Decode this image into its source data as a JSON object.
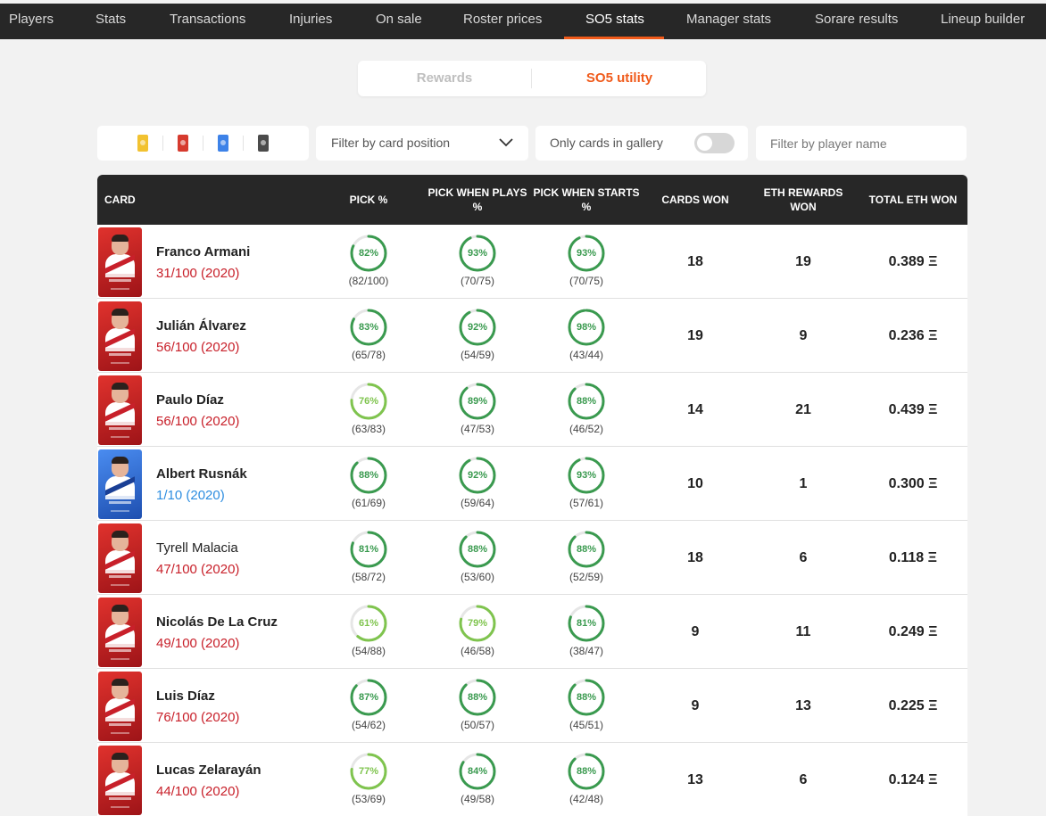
{
  "nav": {
    "tabs": [
      {
        "label": "Players"
      },
      {
        "label": "Stats"
      },
      {
        "label": "Transactions"
      },
      {
        "label": "Injuries"
      },
      {
        "label": "On sale"
      },
      {
        "label": "Roster prices"
      },
      {
        "label": "SO5 stats"
      },
      {
        "label": "Manager stats"
      },
      {
        "label": "Sorare results"
      },
      {
        "label": "Lineup builder"
      }
    ],
    "active": "SO5 stats"
  },
  "switcher": {
    "rewards": "Rewards",
    "utility": "SO5 utility",
    "active": "SO5 utility"
  },
  "filters": {
    "rarities": [
      "limited",
      "rare",
      "super-rare",
      "unique"
    ],
    "position_placeholder": "Filter by card position",
    "gallery_label": "Only cards in gallery",
    "gallery_on": false,
    "name_placeholder": "Filter by player name"
  },
  "table": {
    "headers": {
      "card": "CARD",
      "pick": "PICK %",
      "pick_plays": "PICK WHEN PLAYS %",
      "pick_starts": "PICK WHEN STARTS %",
      "cards_won": "CARDS WON",
      "eth_rewards": "ETH REWARDS WON",
      "total_eth": "TOTAL ETH WON"
    },
    "rows": [
      {
        "name": "Franco Armani",
        "serial": "31/100 (2020)",
        "rarity": "rare",
        "pick": {
          "pct": "82%",
          "frac": "(82/100)",
          "value": 82
        },
        "plays": {
          "pct": "93%",
          "frac": "(70/75)",
          "value": 93
        },
        "starts": {
          "pct": "93%",
          "frac": "(70/75)",
          "value": 93
        },
        "cards_won": "18",
        "eth_rewards": "19",
        "total_eth": "0.389 Ξ"
      },
      {
        "name": "Julián Álvarez",
        "serial": "56/100 (2020)",
        "rarity": "rare",
        "pick": {
          "pct": "83%",
          "frac": "(65/78)",
          "value": 83
        },
        "plays": {
          "pct": "92%",
          "frac": "(54/59)",
          "value": 92
        },
        "starts": {
          "pct": "98%",
          "frac": "(43/44)",
          "value": 98
        },
        "cards_won": "19",
        "eth_rewards": "9",
        "total_eth": "0.236 Ξ"
      },
      {
        "name": "Paulo Díaz",
        "serial": "56/100 (2020)",
        "rarity": "rare",
        "pick": {
          "pct": "76%",
          "frac": "(63/83)",
          "value": 76
        },
        "plays": {
          "pct": "89%",
          "frac": "(47/53)",
          "value": 89
        },
        "starts": {
          "pct": "88%",
          "frac": "(46/52)",
          "value": 88
        },
        "cards_won": "14",
        "eth_rewards": "21",
        "total_eth": "0.439 Ξ"
      },
      {
        "name": "Albert Rusnák",
        "serial": "1/10 (2020)",
        "rarity": "super-rare",
        "pick": {
          "pct": "88%",
          "frac": "(61/69)",
          "value": 88
        },
        "plays": {
          "pct": "92%",
          "frac": "(59/64)",
          "value": 92
        },
        "starts": {
          "pct": "93%",
          "frac": "(57/61)",
          "value": 93
        },
        "cards_won": "10",
        "eth_rewards": "1",
        "total_eth": "0.300 Ξ"
      },
      {
        "name": "Tyrell Malacia",
        "serial": "47/100 (2020)",
        "rarity": "rare",
        "pick": {
          "pct": "81%",
          "frac": "(58/72)",
          "value": 81
        },
        "plays": {
          "pct": "88%",
          "frac": "(53/60)",
          "value": 88
        },
        "starts": {
          "pct": "88%",
          "frac": "(52/59)",
          "value": 88
        },
        "cards_won": "18",
        "eth_rewards": "6",
        "total_eth": "0.118 Ξ"
      },
      {
        "name": "Nicolás De La Cruz",
        "serial": "49/100 (2020)",
        "rarity": "rare",
        "pick": {
          "pct": "61%",
          "frac": "(54/88)",
          "value": 61
        },
        "plays": {
          "pct": "79%",
          "frac": "(46/58)",
          "value": 79
        },
        "starts": {
          "pct": "81%",
          "frac": "(38/47)",
          "value": 81
        },
        "cards_won": "9",
        "eth_rewards": "11",
        "total_eth": "0.249 Ξ"
      },
      {
        "name": "Luis Díaz",
        "serial": "76/100 (2020)",
        "rarity": "rare",
        "pick": {
          "pct": "87%",
          "frac": "(54/62)",
          "value": 87
        },
        "plays": {
          "pct": "88%",
          "frac": "(50/57)",
          "value": 88
        },
        "starts": {
          "pct": "88%",
          "frac": "(45/51)",
          "value": 88
        },
        "cards_won": "9",
        "eth_rewards": "13",
        "total_eth": "0.225 Ξ"
      },
      {
        "name": "Lucas Zelarayán",
        "serial": "44/100 (2020)",
        "rarity": "rare",
        "pick": {
          "pct": "77%",
          "frac": "(53/69)",
          "value": 77
        },
        "plays": {
          "pct": "84%",
          "frac": "(49/58)",
          "value": 84
        },
        "starts": {
          "pct": "88%",
          "frac": "(42/48)",
          "value": 88
        },
        "cards_won": "13",
        "eth_rewards": "6",
        "total_eth": "0.124 Ξ"
      }
    ]
  },
  "colors": {
    "accent": "#f05a1a",
    "rare_serial": "#c8202a",
    "super_rare_serial": "#2d8de0",
    "ring_high": "#3a9a4f",
    "ring_mid": "#7fc44e",
    "ring_track": "#e6e6e6"
  }
}
